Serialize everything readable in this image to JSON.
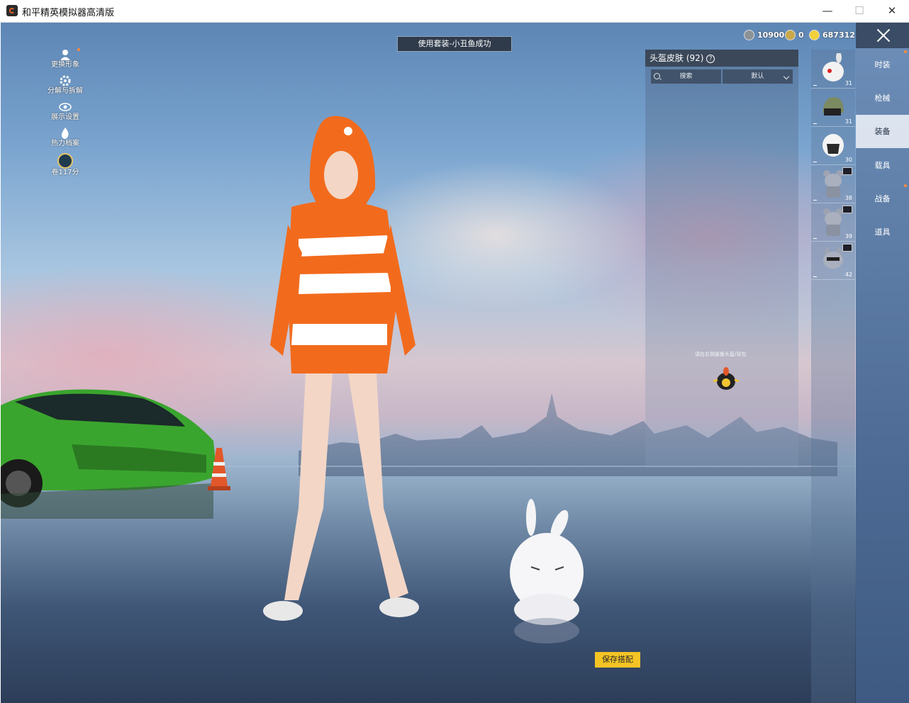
{
  "window": {
    "title": "和平精英模拟器高清版",
    "minimize": "—",
    "maximize": "☐",
    "close": "✕"
  },
  "left_menu": [
    {
      "label": "更换形象",
      "icon": "avatar-icon"
    },
    {
      "label": "分解与拆解",
      "icon": "gear-icon"
    },
    {
      "label": "展示设置",
      "icon": "eye-icon"
    },
    {
      "label": "热力档案",
      "icon": "flame-icon"
    },
    {
      "label": "卷117分",
      "icon": "level-badge-icon"
    }
  ],
  "banner": "使用套装-小丑鱼成功",
  "currency": [
    {
      "icon": "silver-coin-icon",
      "value": "10900",
      "color": "#8b9296"
    },
    {
      "icon": "medal-coin-icon",
      "value": "0",
      "color": "#caa84a"
    },
    {
      "icon": "gold-coin-icon",
      "value": "687312",
      "color": "#f2d03b"
    }
  ],
  "panel": {
    "title": "头盔皮肤 (92)",
    "search_label": "搜索",
    "sort_label": "默认",
    "hint": "请在右侧装备头盔/背包"
  },
  "items": [
    {
      "count": "31",
      "icon": "rabbit-helmet-icon"
    },
    {
      "count": "31",
      "icon": "camo-helmet-icon"
    },
    {
      "count": "30",
      "icon": "white-helmet-icon"
    },
    {
      "count": "38",
      "icon": "bear-costume-icon"
    },
    {
      "count": "39",
      "icon": "bear-costume-icon"
    },
    {
      "count": "42",
      "icon": "cat-costume-icon"
    }
  ],
  "nav": [
    {
      "label": "时装",
      "active": false,
      "dot": true
    },
    {
      "label": "枪械",
      "active": false,
      "dot": false
    },
    {
      "label": "装备",
      "active": true,
      "dot": false
    },
    {
      "label": "载具",
      "active": false,
      "dot": false
    },
    {
      "label": "战备",
      "active": false,
      "dot": true
    },
    {
      "label": "道具",
      "active": false,
      "dot": false
    }
  ],
  "save_button": "保存搭配",
  "colors": {
    "accent": "#f4c424",
    "nav_active_bg": "#e6ecf4",
    "nav_bg": "#5a7aa6",
    "outfit": "#f26b1d"
  }
}
